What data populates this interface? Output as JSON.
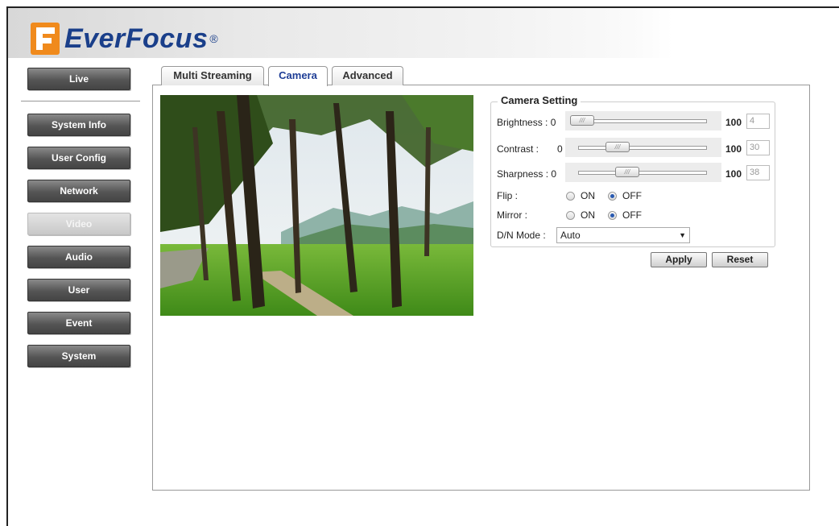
{
  "brand": {
    "name": "EverFocus",
    "reg": "®"
  },
  "nav": [
    {
      "key": "live",
      "label": "Live",
      "active": false
    },
    {
      "key": "system-info",
      "label": "System Info",
      "active": false
    },
    {
      "key": "user-config",
      "label": "User Config",
      "active": false
    },
    {
      "key": "network",
      "label": "Network",
      "active": false
    },
    {
      "key": "video",
      "label": "Video",
      "active": true
    },
    {
      "key": "audio",
      "label": "Audio",
      "active": false
    },
    {
      "key": "user",
      "label": "User",
      "active": false
    },
    {
      "key": "event",
      "label": "Event",
      "active": false
    },
    {
      "key": "system",
      "label": "System",
      "active": false
    }
  ],
  "tabs": [
    {
      "label": "Multi Streaming",
      "active": false
    },
    {
      "label": "Camera",
      "active": true
    },
    {
      "label": "Advanced",
      "active": false
    }
  ],
  "camera_setting": {
    "legend": "Camera Setting",
    "brightness": {
      "label": "Brightness : 0",
      "max": "100",
      "value": "4"
    },
    "contrast": {
      "label": "Contrast :",
      "min": "0",
      "max": "100",
      "value": "30"
    },
    "sharpness": {
      "label": "Sharpness : 0",
      "max": "100",
      "value": "38"
    },
    "flip": {
      "label": "Flip :",
      "on": "ON",
      "off": "OFF",
      "selected": "OFF"
    },
    "mirror": {
      "label": "Mirror :",
      "on": "ON",
      "off": "OFF",
      "selected": "OFF"
    },
    "dn_mode": {
      "label": "D/N Mode :",
      "value": "Auto"
    },
    "apply": "Apply",
    "reset": "Reset"
  },
  "colors": {
    "accent": "#1f3e96",
    "logo_orange": "#f08a1c",
    "nav_dark": "#555555"
  }
}
